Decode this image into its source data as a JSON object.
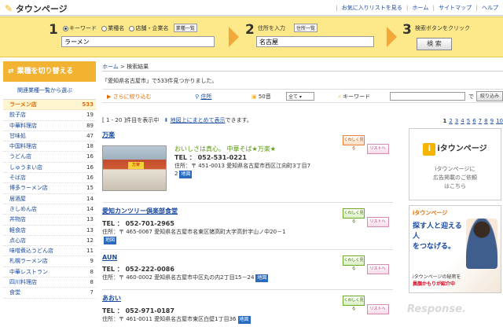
{
  "header": {
    "logo": "タウンページ",
    "links": [
      "お気に入りリストを見る",
      "ホーム",
      "サイトマップ",
      "ヘルプ"
    ]
  },
  "search": {
    "step1": "1",
    "step2": "2",
    "step3": "3",
    "radio_options": [
      "キーワード",
      "業種名",
      "店舗・企業名"
    ],
    "radio_selected": "キーワード",
    "list_button": "業種一覧",
    "keyword_value": "ラーメン",
    "address_label": "住所を入力",
    "address_list_button": "住所一覧",
    "address_value": "名古屋",
    "search_label": "検索ボタンをクリック",
    "search_button": "検 索"
  },
  "sidebar": {
    "title": "業種を切り替える",
    "related_link": "関連業種一覧から選ぶ",
    "items": [
      {
        "label": "ラーメン店",
        "count": "533"
      },
      {
        "label": "餃子店",
        "count": "19"
      },
      {
        "label": "中華料理店",
        "count": "89"
      },
      {
        "label": "甘味処",
        "count": "47"
      },
      {
        "label": "中国料理店",
        "count": "18"
      },
      {
        "label": "うどん店",
        "count": "16"
      },
      {
        "label": "しゅうまい店",
        "count": "16"
      },
      {
        "label": "そば店",
        "count": "16"
      },
      {
        "label": "博多ラーメン店",
        "count": "15"
      },
      {
        "label": "居酒屋",
        "count": "14"
      },
      {
        "label": "きしめん店",
        "count": "14"
      },
      {
        "label": "丼物店",
        "count": "13"
      },
      {
        "label": "軽食店",
        "count": "13"
      },
      {
        "label": "点心店",
        "count": "12"
      },
      {
        "label": "味噌煮込うどん店",
        "count": "11"
      },
      {
        "label": "札幌ラーメン店",
        "count": "9"
      },
      {
        "label": "中華レストラン",
        "count": "8"
      },
      {
        "label": "四川料理店",
        "count": "8"
      },
      {
        "label": "食堂",
        "count": "7"
      }
    ]
  },
  "main": {
    "breadcrumb_home": "ホーム",
    "breadcrumb_sep": ">",
    "breadcrumb_current": "検索結果",
    "result_message": "「愛知県名古屋市」で533件見つかりました。",
    "filter_more": "さらに絞り込む",
    "filter_address": "住所",
    "filter_order": "50音",
    "filter_select": "全て",
    "filter_keyword": "キーワード",
    "filter_de": "で",
    "filter_button": "絞り込み",
    "range_text": "[ 1 - 20 ]件目を表示中",
    "map_link": "地図上にまとめて表示",
    "map_suffix": "できます。",
    "pages": [
      "1",
      "2",
      "3",
      "4",
      "5",
      "6",
      "7",
      "8",
      "9",
      "10"
    ],
    "results": [
      {
        "name": "万楽",
        "tagline": "おいしさは真心。 中華そば★万楽★",
        "tel": "TEL ： 052-531-0221",
        "address": "住所：〒 451-0013 愛知県名古屋市西区江向町3丁目7",
        "address2": "2",
        "map": "地図"
      },
      {
        "name": "愛知カンツリー倶楽部食堂",
        "tel": "TEL ： 052-701-2965",
        "address": "住所：〒 465-0067 愛知県名古屋市名東区猪高町大字高針字山ノ中20－1",
        "map": "地図"
      },
      {
        "name": "AUN",
        "tel": "TEL ： 052-222-0086",
        "address": "住所：〒 460-0002 愛知県名古屋市中区丸の内2丁目15－24",
        "map": "地図"
      },
      {
        "name": "あおい",
        "tel": "TEL ： 052-971-0187",
        "address": "住所：〒 461-0011 愛知県名古屋市東区白壁1丁目36",
        "map": "地図"
      }
    ],
    "btn_kuwashiku": "くわしく見る",
    "btn_list": "リストへ"
  },
  "ads": {
    "ad1_logo": "iタウンページ",
    "ad1_text1": "iタウンページに",
    "ad1_text2": "広告掲載のご依頼",
    "ad1_text3": "はこちら",
    "ad2_logo": "iタウンページ",
    "ad2_big1": "探す人と迎える人",
    "ad2_big2": "をつなげる。",
    "ad2_foot1": "iタウンページの秘密を",
    "ad2_foot2": "員顔かもりが紹介中"
  },
  "watermark": "Response."
}
